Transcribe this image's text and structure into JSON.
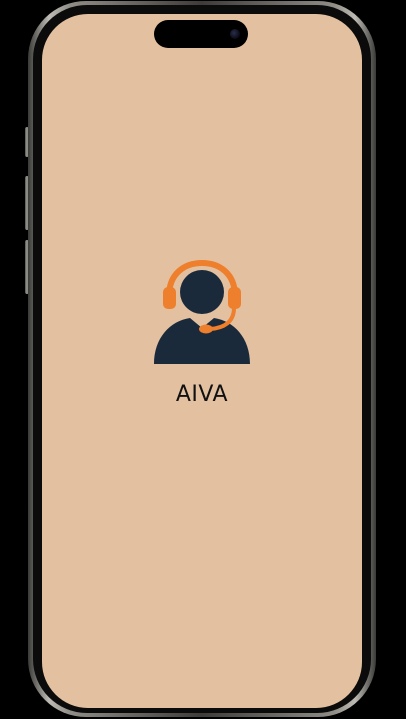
{
  "app": {
    "name": "AIVA",
    "logo_icon": "customer-support-headset-icon"
  },
  "colors": {
    "screen_background": "#E3C1A0",
    "logo_figure": "#1B2A3B",
    "logo_headset": "#EE7F2C",
    "text": "#111111"
  }
}
